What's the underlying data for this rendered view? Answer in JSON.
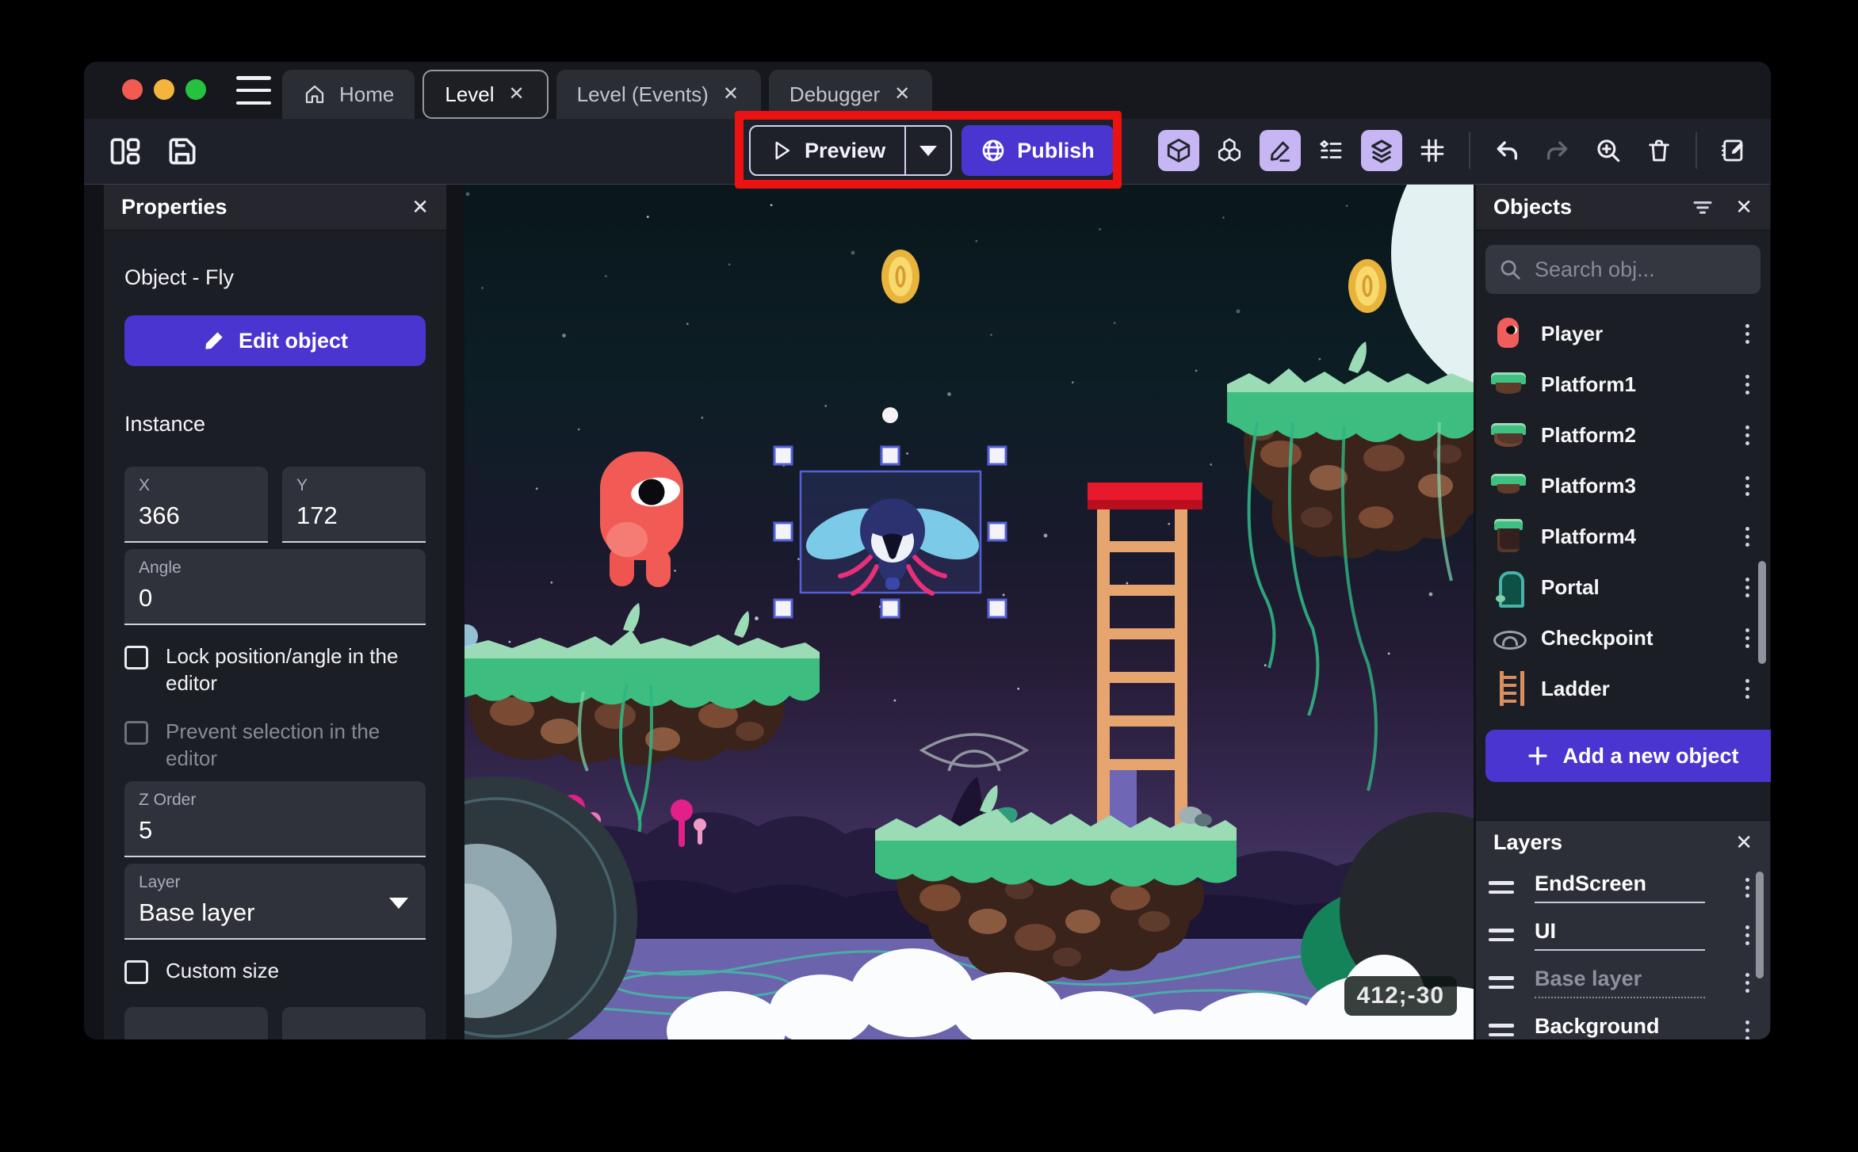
{
  "tabs": [
    {
      "label": "Home",
      "home": true,
      "closable": false,
      "active": false
    },
    {
      "label": "Level",
      "home": false,
      "closable": true,
      "active": true
    },
    {
      "label": "Level (Events)",
      "home": false,
      "closable": true,
      "active": false
    },
    {
      "label": "Debugger",
      "home": false,
      "closable": true,
      "active": false
    }
  ],
  "tab_close_glyph": "✕",
  "toolbar": {
    "preview_label": "Preview",
    "publish_label": "Publish"
  },
  "properties": {
    "title": "Properties",
    "close_glyph": "✕",
    "object_heading": "Object  - Fly",
    "edit_object_label": "Edit object",
    "instance_heading": "Instance",
    "x_label": "X",
    "x_value": "366",
    "y_label": "Y",
    "y_value": "172",
    "angle_label": "Angle",
    "angle_value": "0",
    "lock_label": "Lock position/angle in the editor",
    "prevent_label": "Prevent selection in the editor",
    "zorder_label": "Z Order",
    "zorder_value": "5",
    "layer_label": "Layer",
    "layer_value": "Base layer",
    "custom_size_label": "Custom size"
  },
  "objects": {
    "title": "Objects",
    "close_glyph": "✕",
    "search_placeholder": "Search obj...",
    "items": [
      {
        "name": "Player",
        "icon": "player"
      },
      {
        "name": "Platform1",
        "icon": "platform1"
      },
      {
        "name": "Platform2",
        "icon": "platform2"
      },
      {
        "name": "Platform3",
        "icon": "platform3"
      },
      {
        "name": "Platform4",
        "icon": "platform4"
      },
      {
        "name": "Portal",
        "icon": "portal"
      },
      {
        "name": "Checkpoint",
        "icon": "checkpoint"
      },
      {
        "name": "Ladder",
        "icon": "ladder"
      }
    ],
    "add_button_label": "Add a new object"
  },
  "layers": {
    "title": "Layers",
    "close_glyph": "✕",
    "items": [
      {
        "name": "EndScreen",
        "dimmed": false
      },
      {
        "name": "UI",
        "dimmed": false
      },
      {
        "name": "Base layer",
        "dimmed": true
      },
      {
        "name": "Background",
        "dimmed": false
      }
    ]
  },
  "canvas": {
    "coordinates_badge": "412;-30"
  },
  "colors": {
    "accent": "#4a35d0",
    "annotation": "#ec1212",
    "active_icon_bg": "#c6b6f4",
    "selection": "#5560d6"
  }
}
